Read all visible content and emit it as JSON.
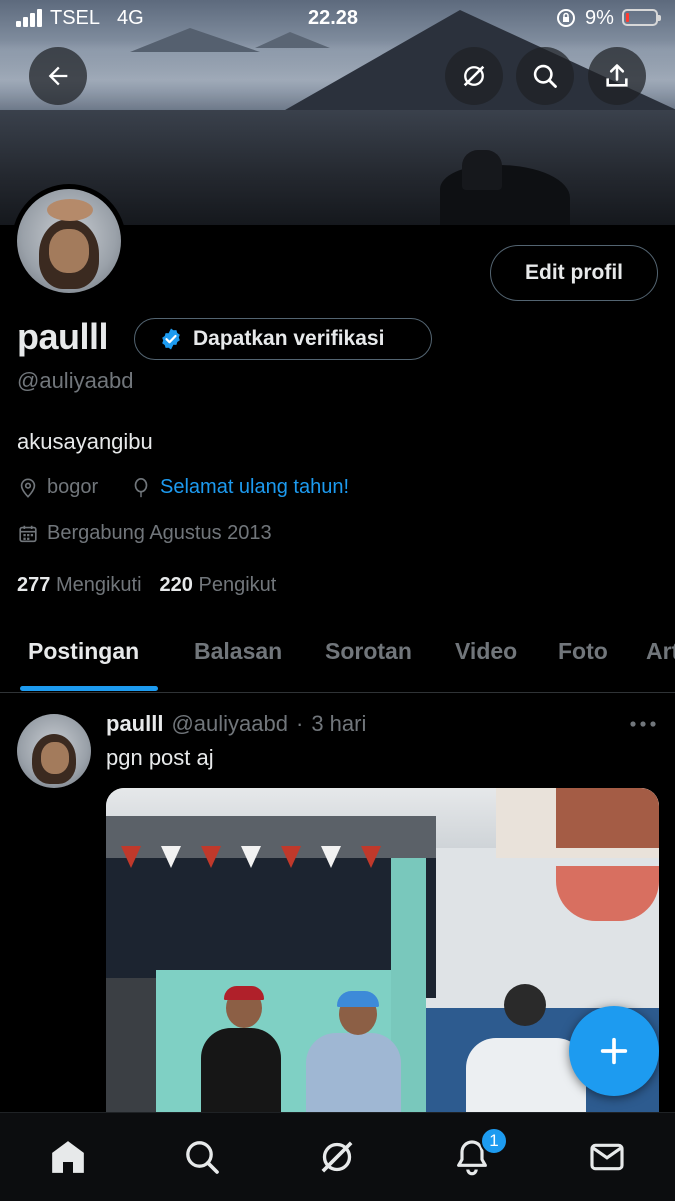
{
  "status_bar": {
    "carrier": "TSEL",
    "network": "4G",
    "time": "22.28",
    "battery_percent": "9%",
    "battery_level": 0.09
  },
  "header_icons": [
    "back-arrow-icon",
    "grok-icon",
    "search-icon",
    "share-icon"
  ],
  "profile": {
    "display_name": "paulll",
    "verify_label": "Dapatkan verifikasi",
    "handle": "@auliyaabd",
    "bio": "akusayangibu",
    "location": "bogor",
    "birthday_text": "Selamat ulang tahun!",
    "joined": "Bergabung Agustus 2013",
    "following_count": "277",
    "following_label": "Mengikuti",
    "followers_count": "220",
    "followers_label": "Pengikut",
    "edit_label": "Edit profil"
  },
  "tabs": [
    {
      "label": "Postingan",
      "active": true
    },
    {
      "label": "Balasan"
    },
    {
      "label": "Sorotan"
    },
    {
      "label": "Video"
    },
    {
      "label": "Foto"
    },
    {
      "label": "Art"
    }
  ],
  "post": {
    "name": "paulll",
    "handle": "@auliyaabd",
    "separator": "·",
    "time": "3 hari",
    "text": "pgn post aj"
  },
  "bottom_nav": {
    "items": [
      "home-icon",
      "search-icon",
      "grok-icon",
      "notifications-icon",
      "messages-icon"
    ],
    "notification_badge": "1"
  },
  "colors": {
    "accent": "#1d9bf0",
    "background": "#000000",
    "text": "#e7e9ea",
    "muted": "#71767b",
    "border": "#536471"
  }
}
